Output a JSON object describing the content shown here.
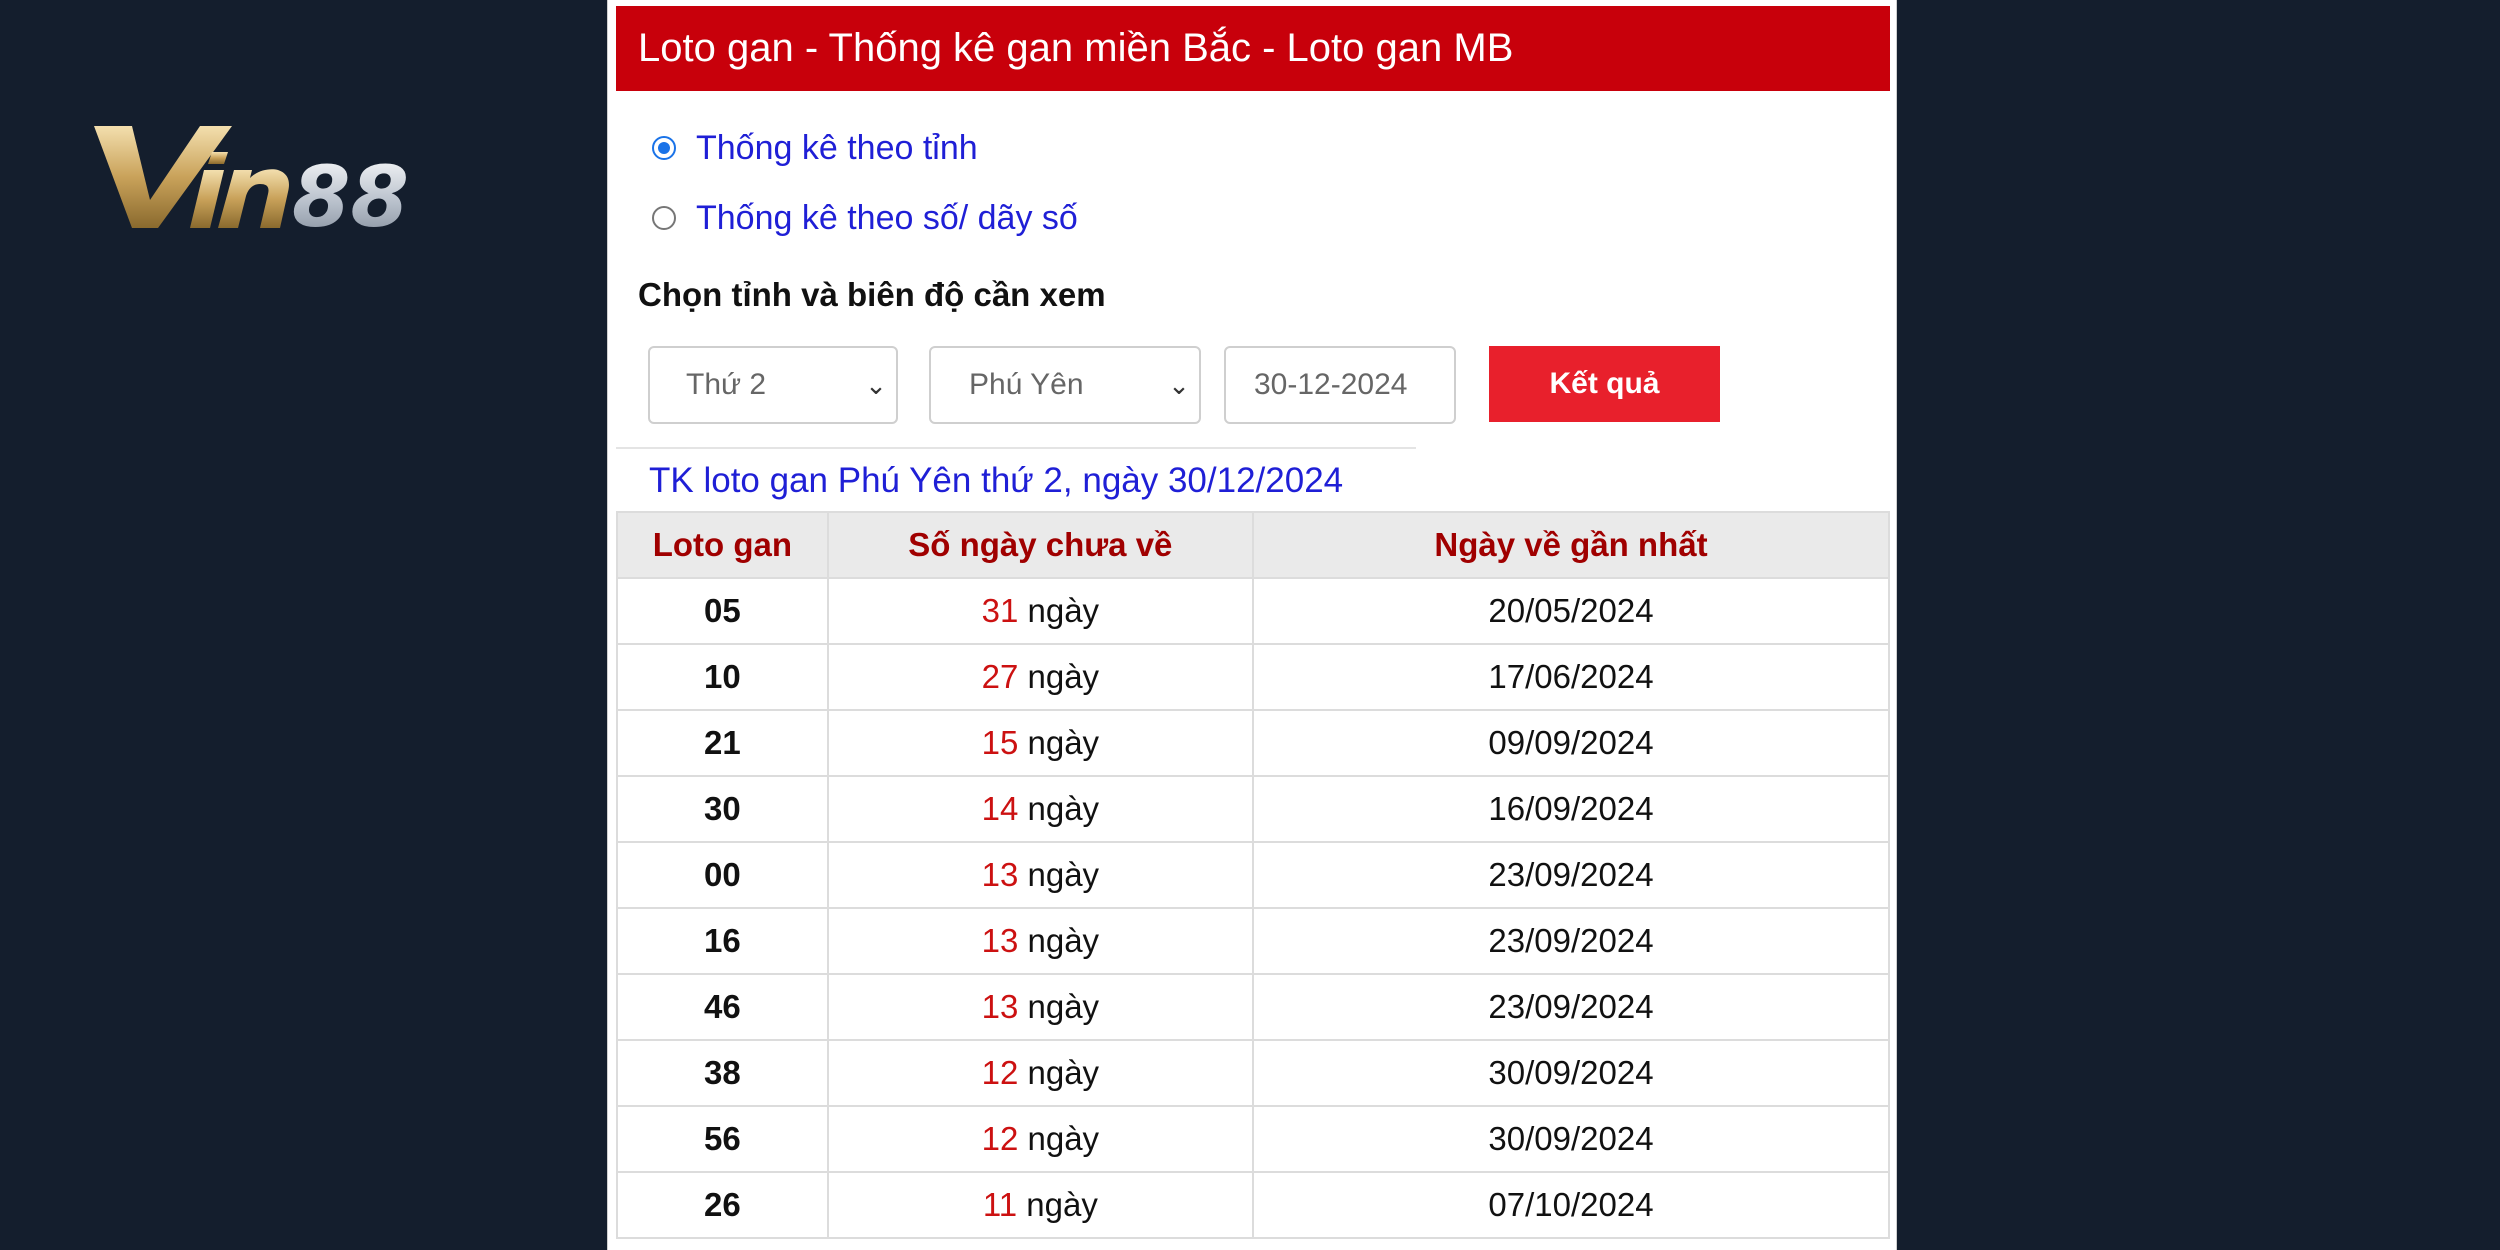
{
  "logo": {
    "text": "Vin88"
  },
  "header": {
    "title": "Loto gan - Thống kê gan miền Bắc - Loto gan MB"
  },
  "radios": [
    {
      "label": "Thống kê theo tỉnh",
      "checked": true
    },
    {
      "label": "Thống kê theo số/ dãy số",
      "checked": false
    }
  ],
  "form": {
    "section_label": "Chọn tỉnh và biên độ cần xem",
    "day_select": "Thứ 2",
    "province_select": "Phú Yên",
    "date_value": "30-12-2024",
    "submit_label": "Kết quả"
  },
  "subtitle": "TK loto gan Phú Yên thứ 2, ngày 30/12/2024",
  "table": {
    "headers": [
      "Loto gan",
      "Số ngày chưa về",
      "Ngày về gần nhất"
    ],
    "unit": "ngày",
    "rows": [
      {
        "num": "05",
        "days": "31",
        "last": "20/05/2024"
      },
      {
        "num": "10",
        "days": "27",
        "last": "17/06/2024"
      },
      {
        "num": "21",
        "days": "15",
        "last": "09/09/2024"
      },
      {
        "num": "30",
        "days": "14",
        "last": "16/09/2024"
      },
      {
        "num": "00",
        "days": "13",
        "last": "23/09/2024"
      },
      {
        "num": "16",
        "days": "13",
        "last": "23/09/2024"
      },
      {
        "num": "46",
        "days": "13",
        "last": "23/09/2024"
      },
      {
        "num": "38",
        "days": "12",
        "last": "30/09/2024"
      },
      {
        "num": "56",
        "days": "12",
        "last": "30/09/2024"
      },
      {
        "num": "26",
        "days": "11",
        "last": "07/10/2024"
      }
    ]
  },
  "colors": {
    "background": "#141e2d",
    "header": "#c8000b",
    "button": "#e8202c",
    "link_blue": "#1f1fd6",
    "day_red": "#cc1111"
  }
}
